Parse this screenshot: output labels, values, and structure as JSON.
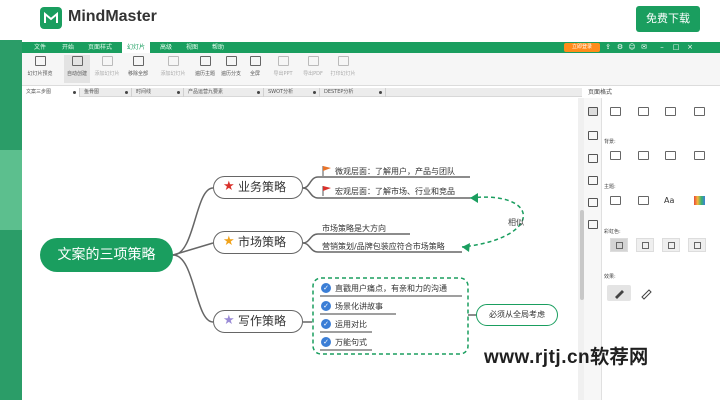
{
  "app": {
    "name": "MindMaster",
    "download_label": "免费下载"
  },
  "menu": {
    "items": [
      "文件",
      "开始",
      "页面样式",
      "幻灯片",
      "高级",
      "视图",
      "帮助"
    ],
    "active_index": 3,
    "vip_label": "立即登录"
  },
  "ribbon": {
    "buttons": [
      {
        "label": "幻灯片预览",
        "enabled": true
      },
      {
        "label": "自动创建",
        "enabled": true
      },
      {
        "label": "添加幻灯片",
        "enabled": false
      },
      {
        "label": "移除全部",
        "enabled": true
      },
      {
        "label": "添加幻灯片",
        "enabled": false
      },
      {
        "label": "遍历主题",
        "enabled": true
      },
      {
        "label": "遍历分支",
        "enabled": true
      },
      {
        "label": "全屏",
        "enabled": true
      },
      {
        "label": "导出PPT",
        "enabled": false
      },
      {
        "label": "导出PDF",
        "enabled": false
      },
      {
        "label": "打印幻灯片",
        "enabled": false
      }
    ]
  },
  "tabs": [
    "文案三步图",
    "鱼骨图",
    "时间线",
    "产品运营九要素",
    "SWOT分析",
    "DESTEP分析"
  ],
  "active_tab": 0,
  "panel": {
    "title": "页面格式",
    "background_label": "背景:",
    "theme_label": "主题:",
    "rainbow_label": "彩虹色:",
    "effect_label": "效果:",
    "font_icon_text": "Aa"
  },
  "mindmap": {
    "root": "文案的三项策略",
    "branches": [
      {
        "label": "业务策略",
        "star_color": "#d9312b",
        "leaves": [
          "微观层面：了解用户，产品与团队",
          "宏观层面：了解市场、行业和竞品"
        ]
      },
      {
        "label": "市场策略",
        "star_color": "#f0a21a",
        "leaves": [
          "市场策略是大方向",
          "营销策划/品牌包装应符合市场策略"
        ]
      },
      {
        "label": "写作策略",
        "star_color": "#9a8bd6",
        "leaves": [
          "直戳用户痛点，有亲和力的沟通",
          "场景化讲故事",
          "运用对比",
          "万能句式"
        ]
      }
    ],
    "relation_label": "相似",
    "summary_label": "必须从全局考虑"
  },
  "watermark": "www.rjtj.cn软荐网"
}
